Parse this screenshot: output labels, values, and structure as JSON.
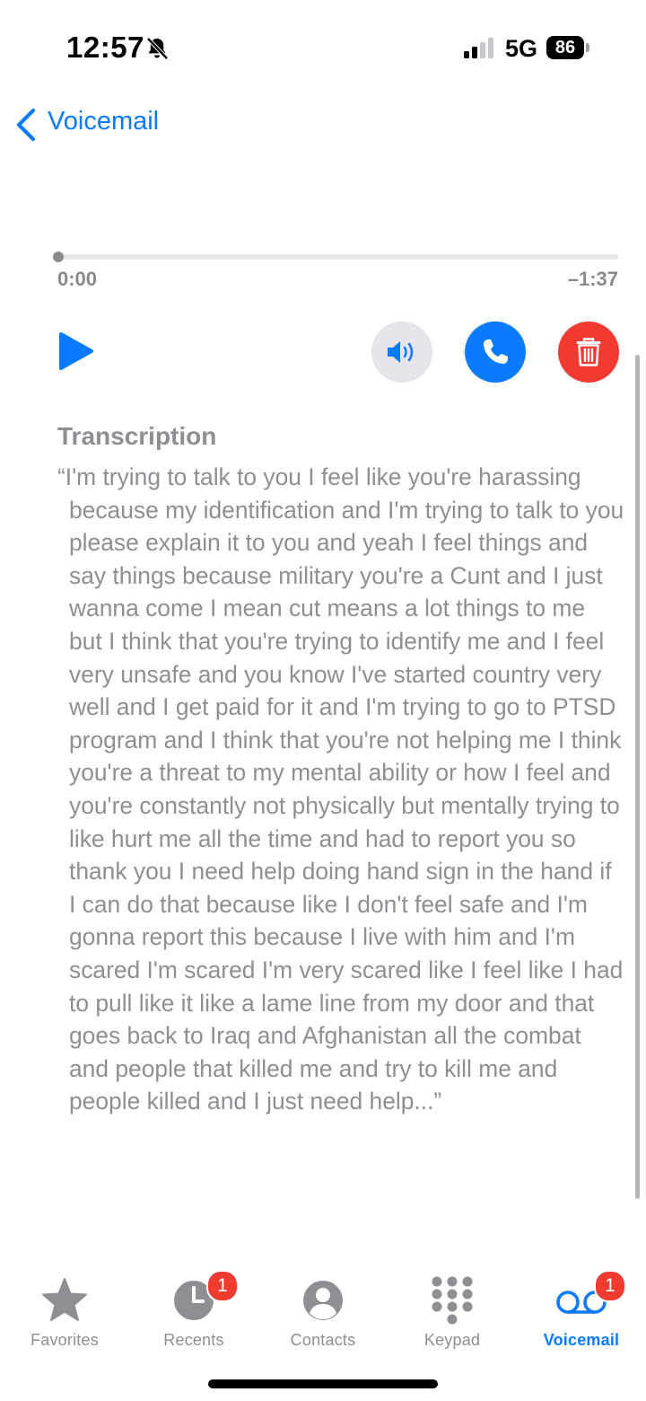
{
  "status_bar": {
    "time": "12:57",
    "network": "5G",
    "battery": "86",
    "icons": [
      "bell-slash-icon",
      "signal-icon",
      "battery-icon"
    ]
  },
  "nav": {
    "back_label": "Voicemail"
  },
  "player": {
    "elapsed": "0:00",
    "remaining": "–1:37",
    "progress": 0.0
  },
  "transcription": {
    "title": "Transcription",
    "text": "“I'm trying to talk to you I feel like you're harassing because my identification and I'm trying to talk to you please explain it to you and yeah I feel things and say things because military you're a Cunt and I just wanna come I mean cut means a lot things to me but I think that you're trying to identify me and I feel very unsafe and you know I've started country very well and I get paid for it and I'm trying to go to PTSD program and I think that you're not helping me I think you're a threat to my mental ability or how I feel and you're constantly not physically but mentally trying to like hurt me all the time and had to report you so thank you I need help doing hand sign in the hand if I can do that because like I don't feel safe and I'm gonna report this because I live with him and I'm scared I'm scared I'm very scared like I feel like I had to pull like it like a lame line from my door and that goes back to Iraq and Afghanistan all the combat and people that killed me and try to kill me and people killed and I just need help...”"
  },
  "tabs": [
    {
      "label": "Favorites",
      "icon": "star-icon",
      "active": false
    },
    {
      "label": "Recents",
      "icon": "clock-icon",
      "active": false,
      "badge": "1"
    },
    {
      "label": "Contacts",
      "icon": "person-icon",
      "active": false
    },
    {
      "label": "Keypad",
      "icon": "keypad-icon",
      "active": false
    },
    {
      "label": "Voicemail",
      "icon": "voicemail-icon",
      "active": true,
      "badge": "1"
    }
  ],
  "colors": {
    "accent": "#0a7aff",
    "destructive": "#f23b30",
    "secondary_text": "#8e8e93"
  }
}
